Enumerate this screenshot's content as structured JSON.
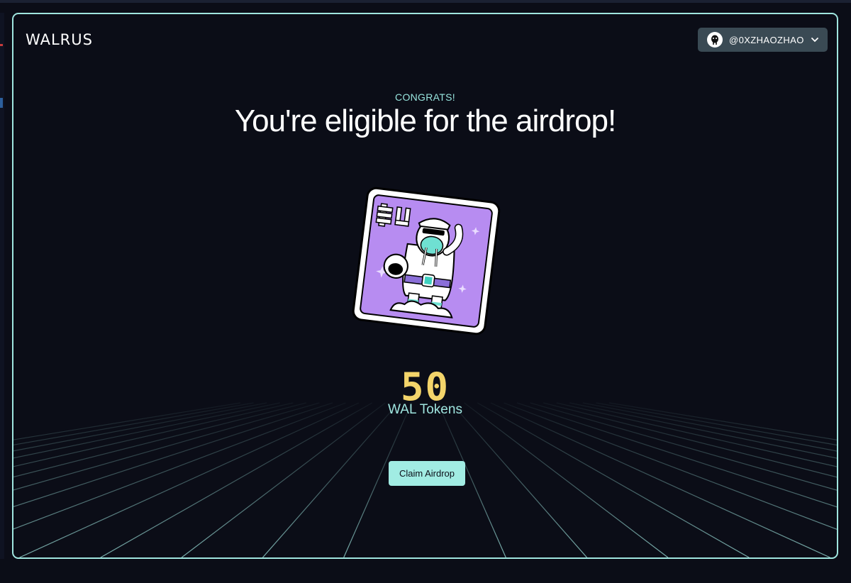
{
  "header": {
    "logo_text": "WALRUS",
    "user": {
      "handle": "@0XZHAOZHAO",
      "avatar_icon": "walrus-avatar-icon",
      "menu_icon": "chevron-down-icon"
    }
  },
  "main": {
    "eyebrow": "CONGRATS!",
    "headline": "You're eligible for the airdrop!",
    "card_image": "walrus-astronaut-nft-card",
    "token_amount": "50",
    "token_unit": "WAL Tokens",
    "claim_button_label": "Claim Airdrop"
  },
  "colors": {
    "background": "#0b0d17",
    "frame_border": "#9fe5df",
    "accent_teal": "#a1ece3",
    "amount_yellow": "#f3d46a",
    "card_purple": "#b78cf1",
    "user_button_bg": "#3a4a54"
  }
}
